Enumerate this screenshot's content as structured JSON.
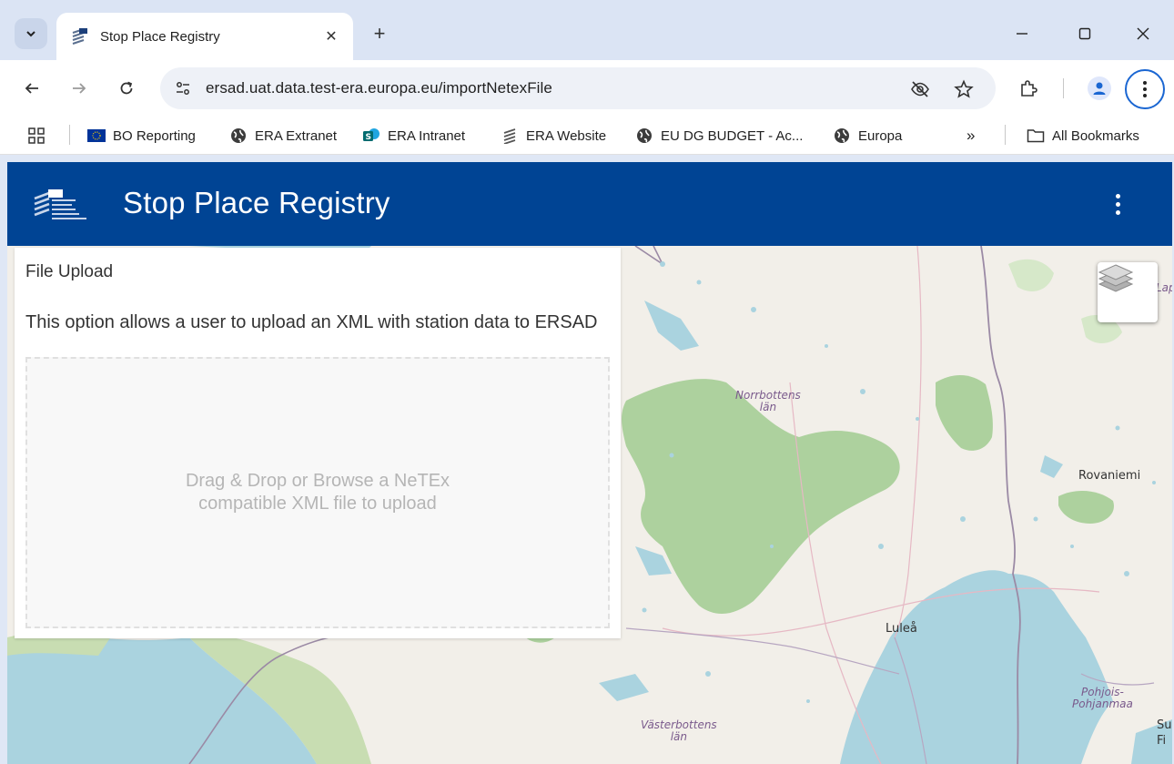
{
  "browser": {
    "tab": {
      "title": "Stop Place Registry",
      "close_glyph": "✕"
    },
    "new_tab_glyph": "+",
    "window_controls": {
      "minimize": "—",
      "maximize": "☐",
      "close": "✕"
    },
    "address_bar": {
      "url": "ersad.uat.data.test-era.europa.eu/importNetexFile"
    },
    "bookmarks": [
      {
        "label": "BO Reporting",
        "icon": "eu-flag-icon"
      },
      {
        "label": "ERA Extranet",
        "icon": "globe-icon"
      },
      {
        "label": "ERA Intranet",
        "icon": "sharepoint-icon"
      },
      {
        "label": "ERA Website",
        "icon": "era-logo-icon"
      },
      {
        "label": "EU DG BUDGET - Ac...",
        "icon": "globe-icon"
      },
      {
        "label": "Europa",
        "icon": "globe-icon"
      }
    ],
    "more_bookmarks_glyph": "»",
    "all_bookmarks_label": "All Bookmarks"
  },
  "app": {
    "title": "Stop Place Registry",
    "header_color": "#004494"
  },
  "upload": {
    "title": "File Upload",
    "description": "This option allows a user to upload an XML with station data to ERSAD",
    "dropzone_text": "Drag & Drop or Browse a NeTEx compatible XML file to upload"
  },
  "map": {
    "labels": {
      "norrbotten": "Norrbottens\nlän",
      "vasterbotten": "Västerbottens\nlän",
      "pohjois": "Pohjois-\nPohjanmaa",
      "lapland_partial": "Lapp",
      "fi_partial": "Su\nFi"
    },
    "cities": {
      "rovaniemi": "Rovaniemi",
      "lulea": "Luleå"
    }
  }
}
